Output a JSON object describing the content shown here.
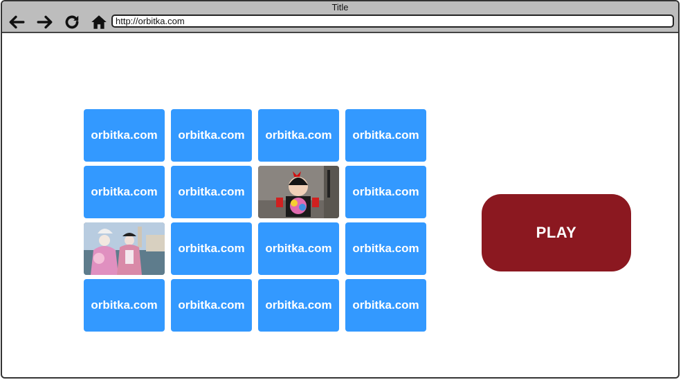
{
  "window": {
    "title": "Title",
    "url": "http://orbitka.com"
  },
  "colors": {
    "card_back": "#3399ff",
    "play_button": "#8b1820",
    "titlebar": "#bdbdbd"
  },
  "nav": {
    "back_icon": "arrow-left-icon",
    "forward_icon": "arrow-right-icon",
    "reload_icon": "reload-icon",
    "home_icon": "home-icon"
  },
  "cards": [
    {
      "state": "back",
      "label": "orbitka.com"
    },
    {
      "state": "back",
      "label": "orbitka.com"
    },
    {
      "state": "back",
      "label": "orbitka.com"
    },
    {
      "state": "back",
      "label": "orbitka.com"
    },
    {
      "state": "back",
      "label": "orbitka.com"
    },
    {
      "state": "back",
      "label": "orbitka.com"
    },
    {
      "state": "revealed",
      "label": ""
    },
    {
      "state": "back",
      "label": "orbitka.com"
    },
    {
      "state": "revealed",
      "label": ""
    },
    {
      "state": "back",
      "label": "orbitka.com"
    },
    {
      "state": "back",
      "label": "orbitka.com"
    },
    {
      "state": "back",
      "label": "orbitka.com"
    },
    {
      "state": "back",
      "label": "orbitka.com"
    },
    {
      "state": "back",
      "label": "orbitka.com"
    },
    {
      "state": "back",
      "label": "orbitka.com"
    },
    {
      "state": "back",
      "label": "orbitka.com"
    }
  ],
  "play_button": {
    "label": "PLAY"
  }
}
